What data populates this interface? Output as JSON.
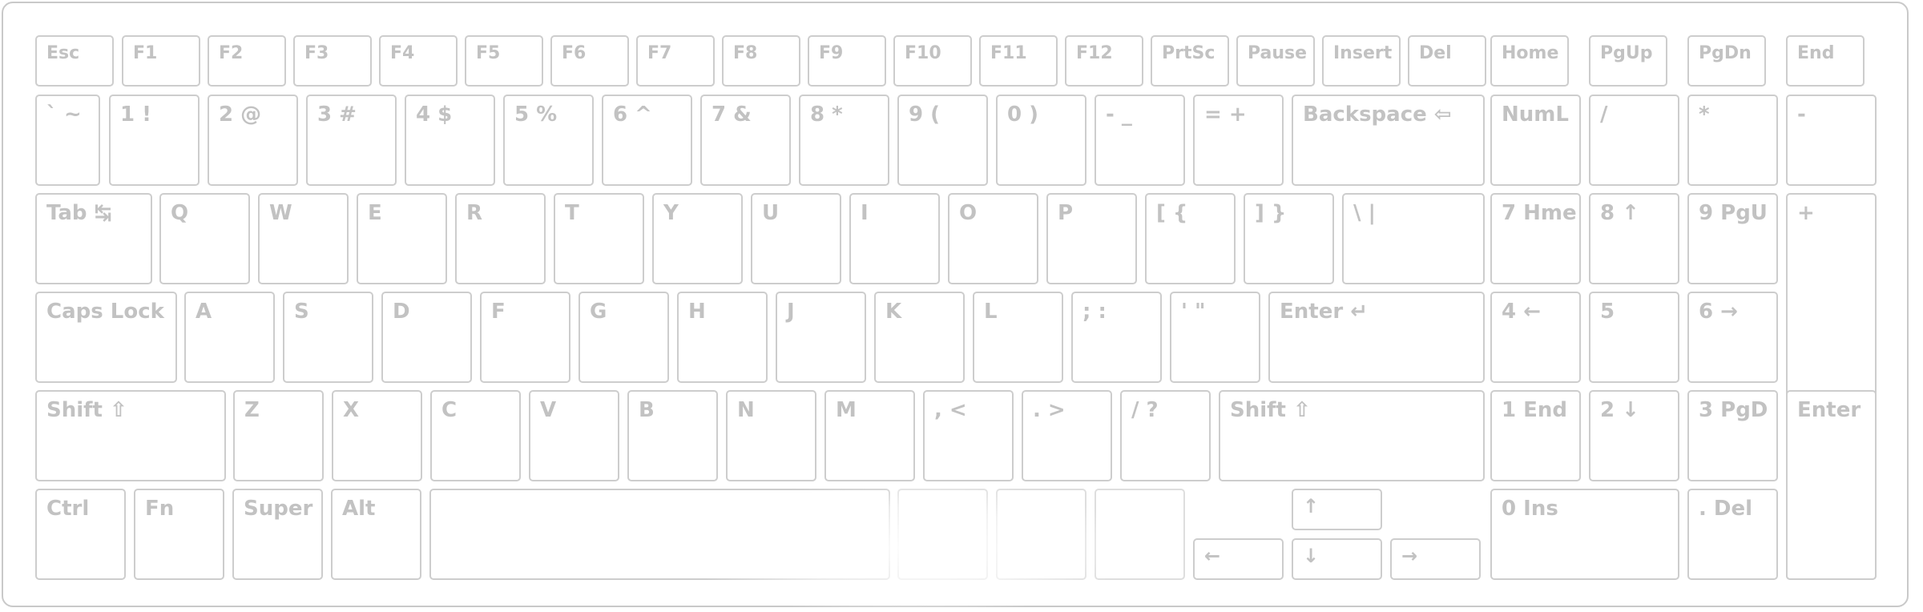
{
  "keyboard": {
    "function_row": [
      "Esc",
      "F1",
      "F2",
      "F3",
      "F4",
      "F5",
      "F6",
      "F7",
      "F8",
      "F9",
      "F10",
      "F11",
      "F12",
      "PrtSc",
      "Pause",
      "Insert",
      "Del",
      "Home",
      "PgUp",
      "PgDn",
      "End"
    ],
    "number_row": [
      "` ~",
      "1 !",
      "2 @",
      "3 #",
      "4 $",
      "5 %",
      "6 ^",
      "7 &",
      "8 *",
      "9 (",
      "0 )",
      "- _",
      "= +",
      "Backspace ⇦",
      "NumL",
      "/",
      "*",
      "-"
    ],
    "tab_row": [
      "Tab ↹",
      "Q",
      "W",
      "E",
      "R",
      "T",
      "Y",
      "U",
      "I",
      "O",
      "P",
      "[ {",
      "] }",
      "\\ |",
      "7 Hme",
      "8 ↑",
      "9 PgU",
      "+"
    ],
    "caps_row": [
      "Caps Lock",
      "A",
      "S",
      "D",
      "F",
      "G",
      "H",
      "J",
      "K",
      "L",
      "; :",
      "' \"",
      "Enter ↵",
      "4 ←",
      "5",
      "6 →"
    ],
    "shift_row": [
      "Shift ⇧",
      "Z",
      "X",
      "C",
      "V",
      "B",
      "N",
      "M",
      ", <",
      ". >",
      "/ ?",
      "Shift ⇧",
      "1 End",
      "2 ↓",
      "3 PgD",
      "Enter"
    ],
    "bottom_row": [
      "Ctrl",
      "Fn",
      "Super",
      "Alt",
      "",
      "",
      "",
      "",
      "↑",
      "←",
      "↓",
      "→",
      "0 Ins",
      ". Del"
    ]
  }
}
